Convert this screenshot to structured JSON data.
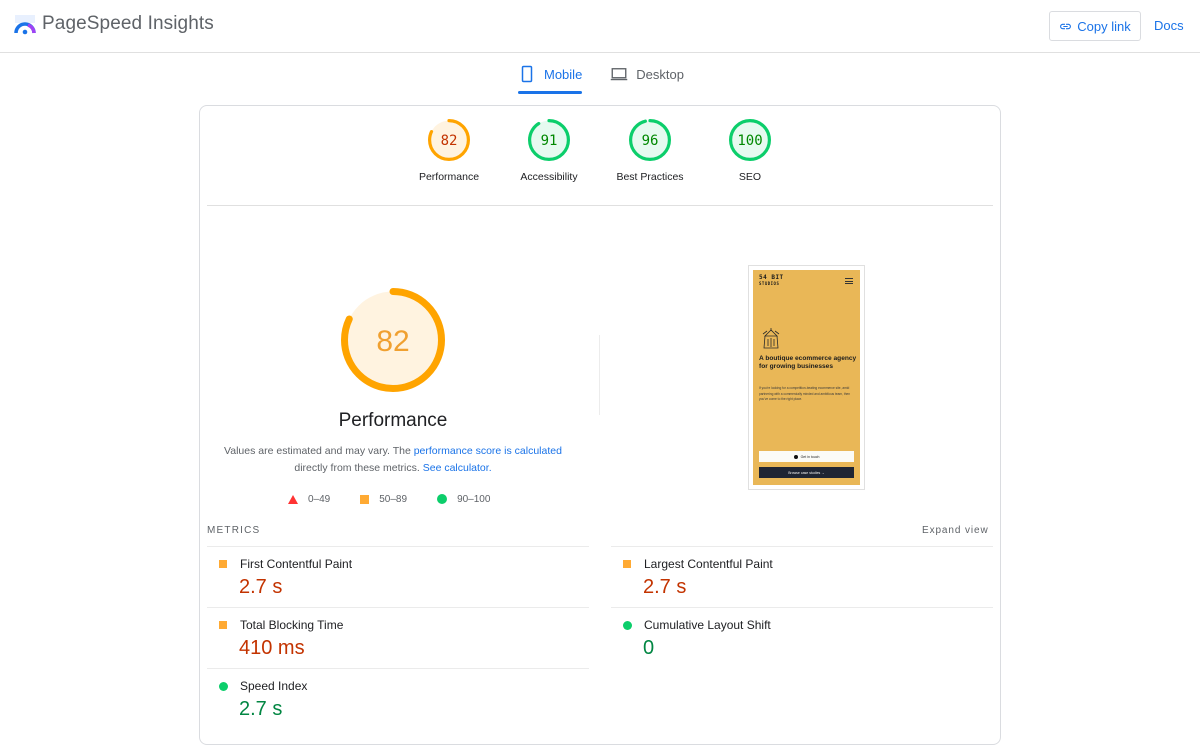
{
  "header": {
    "app_title": "PageSpeed Insights",
    "logo_icon": "pagespeed-logo-icon",
    "copy_link_label": "Copy link",
    "copy_link_icon": "link-icon",
    "docs_label": "Docs"
  },
  "tabs": [
    {
      "label": "Mobile",
      "icon": "smartphone-icon",
      "active": true
    },
    {
      "label": "Desktop",
      "icon": "laptop-icon",
      "active": false
    }
  ],
  "category_scores": [
    {
      "label": "Performance",
      "score": 82,
      "rating": "average"
    },
    {
      "label": "Accessibility",
      "score": 91,
      "rating": "pass"
    },
    {
      "label": "Best Practices",
      "score": 96,
      "rating": "pass"
    },
    {
      "label": "SEO",
      "score": 100,
      "rating": "pass"
    }
  ],
  "performance": {
    "score": 82,
    "title": "Performance",
    "desc_prefix": "Values are estimated and may vary. The ",
    "desc_link1": "performance score is calculated",
    "desc_middle": " directly from these metrics. ",
    "desc_link2": "See calculator."
  },
  "legend": [
    {
      "shape": "triangle",
      "range": "0–49",
      "color": "#ff3333"
    },
    {
      "shape": "square",
      "range": "50–89",
      "color": "#ffaa33"
    },
    {
      "shape": "circle",
      "range": "90–100",
      "color": "#0cce6b"
    }
  ],
  "screenshot": {
    "brand_line1": "54 BIT",
    "brand_line2": "STUDIOS",
    "headline": "A boutique ecommerce agency for growing businesses",
    "body": "If you're looking for a competition-beating ecommerce site, amid partnering with a commercially minded and ambitious team, then you've come to the right place.",
    "primary_button": "Get in touch",
    "secondary_button": "Browse case studies →"
  },
  "metrics": {
    "section_label": "METRICS",
    "expand_label": "Expand view",
    "items": [
      {
        "name": "First Contentful Paint",
        "value": "2.7 s",
        "rating": "average"
      },
      {
        "name": "Largest Contentful Paint",
        "value": "2.7 s",
        "rating": "average"
      },
      {
        "name": "Total Blocking Time",
        "value": "410 ms",
        "rating": "average"
      },
      {
        "name": "Cumulative Layout Shift",
        "value": "0",
        "rating": "pass"
      },
      {
        "name": "Speed Index",
        "value": "2.7 s",
        "rating": "pass"
      }
    ]
  },
  "colors": {
    "accent": "#1a73e8",
    "average": "#ffa400",
    "average_text": "#c33300",
    "pass": "#0cce6b",
    "pass_text": "#008800",
    "fail": "#ff3333"
  }
}
